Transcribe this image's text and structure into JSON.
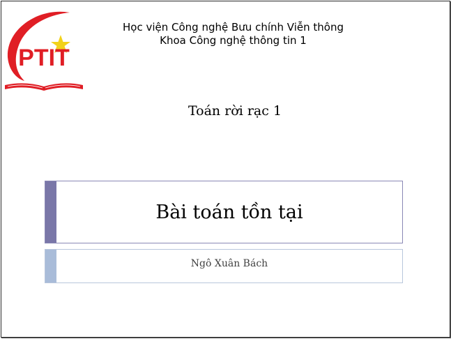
{
  "header": {
    "institution_line1": "Học viện Công nghệ Bưu chính Viễn thông",
    "institution_line2": "Khoa Công nghệ thông tin 1"
  },
  "logo": {
    "text": "PTIT",
    "icon": "ptit-logo-icon",
    "color_red": "#e01e25",
    "color_star": "#f2d21b"
  },
  "course": {
    "title": "Toán rời rạc 1"
  },
  "lecture": {
    "title": "Bài toán tồn tại",
    "author": "Ngô Xuân Bách"
  },
  "colors": {
    "title_accent": "#7a77a8",
    "author_accent": "#a9bcd9"
  }
}
